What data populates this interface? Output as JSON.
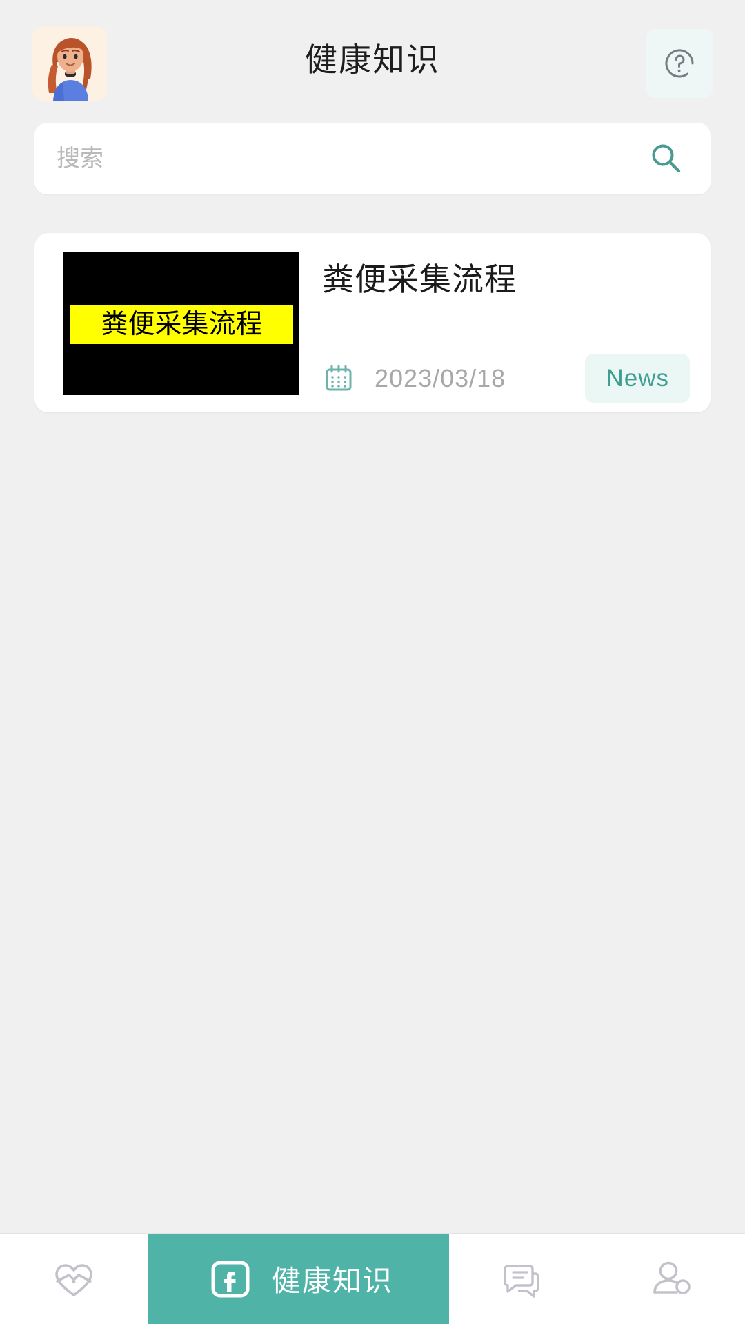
{
  "header": {
    "title": "健康知识",
    "avatar_icon": "user-avatar-illustration",
    "help_icon": "question-circle-icon"
  },
  "search": {
    "placeholder": "搜索",
    "value": "",
    "icon": "search-icon"
  },
  "article_list": [
    {
      "title": "粪便采集流程",
      "thumbnail_caption": "粪便采集流程",
      "thumbnail_bg": "#000000",
      "thumbnail_caption_bg": "#ffff00",
      "date": "2023/03/18",
      "date_icon": "calendar-icon",
      "tag": "News"
    }
  ],
  "bottom_nav": {
    "items": [
      {
        "label": "",
        "icon": "heart-pulse-icon",
        "active": false
      },
      {
        "label": "健康知识",
        "icon": "knowledge-card-icon",
        "active": true
      },
      {
        "label": "",
        "icon": "chat-bubbles-icon",
        "active": false
      },
      {
        "label": "",
        "icon": "user-account-icon",
        "active": false
      }
    ]
  },
  "colors": {
    "page_bg": "#f0f0f0",
    "accent": "#4fb3a8",
    "accent_soft": "#ebf7f4",
    "card_bg": "#ffffff",
    "muted_text": "#a8a8a8",
    "nav_inactive": "#c2c2cb"
  }
}
